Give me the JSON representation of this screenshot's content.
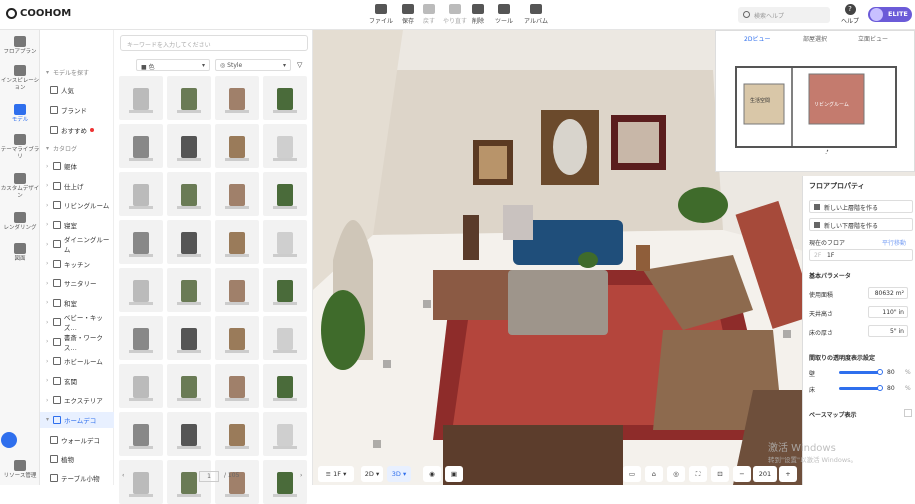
{
  "app": {
    "logo": "COOHOM"
  },
  "toolbar": {
    "items": [
      {
        "label": "ファイル",
        "icon": "file-icon",
        "dim": false
      },
      {
        "label": "保存",
        "icon": "save-icon",
        "dim": false
      },
      {
        "label": "戻す",
        "icon": "undo-icon",
        "dim": true
      },
      {
        "label": "やり直す",
        "icon": "redo-icon",
        "dim": true
      },
      {
        "label": "削除",
        "icon": "delete-icon",
        "dim": false
      },
      {
        "label": "ツール",
        "icon": "tool-icon",
        "dim": false
      },
      {
        "label": "アルバム",
        "icon": "album-icon",
        "dim": false
      }
    ]
  },
  "header": {
    "search_placeholder": "検索ヘルプ",
    "help_label": "ヘルプ",
    "badge": "ELITE"
  },
  "rail": [
    {
      "label": "フロアプラン",
      "icon": "floorplan-icon"
    },
    {
      "label": "インスピレーション",
      "icon": "bulb-icon"
    },
    {
      "label": "モデル",
      "icon": "sofa-icon",
      "active": true
    },
    {
      "label": "テーマライブラリ",
      "icon": "crown-icon"
    },
    {
      "label": "カスタムデザイン",
      "icon": "custom-icon"
    },
    {
      "label": "レンダリング",
      "icon": "camera-icon"
    },
    {
      "label": "図面",
      "icon": "drawing-icon"
    },
    {
      "label": "リソース管理",
      "icon": "resource-icon"
    }
  ],
  "catalog": {
    "search_placeholder": "キーワードを入力してください",
    "explore_header": "モデルを探す",
    "explore": [
      "人気",
      "ブランド",
      "おすすめ"
    ],
    "catalog_header": "カタログ",
    "items": [
      "躯体",
      "仕上げ",
      "リビングルーム",
      "寝室",
      "ダイニングルーム",
      "キッチン",
      "サニタリー",
      "和室",
      "ベビー・キッズ…",
      "書斎・ワークス…",
      "ホビールーム",
      "玄関",
      "エクステリア",
      "ホームデコ"
    ],
    "subitems": [
      "ウォールデコ",
      "植物",
      "テーブル小物"
    ]
  },
  "product": {
    "filter_color": "色",
    "filter_style": "Style",
    "page": "1",
    "total": "/ 105"
  },
  "canvas": {
    "floor": "1F",
    "view2d": "2D",
    "view3d": "3D",
    "zoom": "201"
  },
  "minimap": {
    "tabs": [
      "2Dビュー",
      "部屋選択",
      "立面ビュー"
    ],
    "room_a": "生活空間",
    "room_b": "リビングルーム"
  },
  "props": {
    "title": "フロアプロパティ",
    "add_upper": "新しい上層階を作る",
    "add_lower": "新しい下層階を作る",
    "current_floor": "現在のフロア",
    "current_floor_link": "平行移動",
    "floor_value": "1F",
    "basic_params": "基本パラメータ",
    "area_label": "使用面積",
    "area": "80632",
    "area_unit": "m²",
    "ceiling_label": "天井高さ",
    "ceiling": "110\"",
    "ceiling_unit": "in",
    "thick_label": "床の厚さ",
    "thick": "5\"",
    "thick_unit": "in",
    "transp": "間取りの透明度表示設定",
    "wall": "壁",
    "wall_val": "80",
    "floor2": "床",
    "floor_val": "80",
    "pct": "%",
    "basemap": "ベースマップ表示"
  },
  "watermark": {
    "line1": "激活 Windows",
    "line2": "转到\"设置\"以激活 Windows。"
  }
}
